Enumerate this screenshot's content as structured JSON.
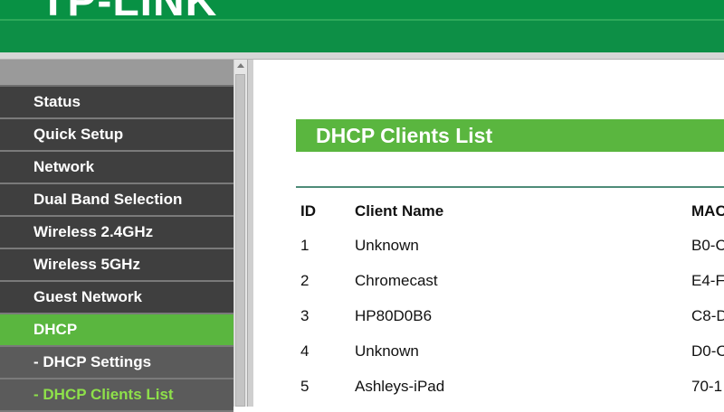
{
  "header": {
    "logo_text": "TP-LINK"
  },
  "sidebar": {
    "items": [
      {
        "label": "Status"
      },
      {
        "label": "Quick Setup"
      },
      {
        "label": "Network"
      },
      {
        "label": "Dual Band Selection"
      },
      {
        "label": "Wireless 2.4GHz"
      },
      {
        "label": "Wireless 5GHz"
      },
      {
        "label": "Guest Network"
      },
      {
        "label": "DHCP"
      },
      {
        "label": "- DHCP Settings"
      },
      {
        "label": "- DHCP Clients List"
      }
    ],
    "active_index": 7,
    "current_sub_index": 9
  },
  "main": {
    "title": "DHCP Clients List",
    "table": {
      "headers": [
        "ID",
        "Client Name",
        "MAC"
      ],
      "rows": [
        {
          "id": "1",
          "name": "Unknown",
          "mac": "B0-C"
        },
        {
          "id": "2",
          "name": "Chromecast",
          "mac": "E4-F"
        },
        {
          "id": "3",
          "name": "HP80D0B6",
          "mac": "C8-D"
        },
        {
          "id": "4",
          "name": "Unknown",
          "mac": "D0-C"
        },
        {
          "id": "5",
          "name": "Ashleys-iPad",
          "mac": "70-1"
        }
      ]
    }
  },
  "colors": {
    "brand_green": "#089144",
    "accent_green": "#5ab63f",
    "current_link": "#8ee04a",
    "menu_dark": "#3f3f3f"
  }
}
